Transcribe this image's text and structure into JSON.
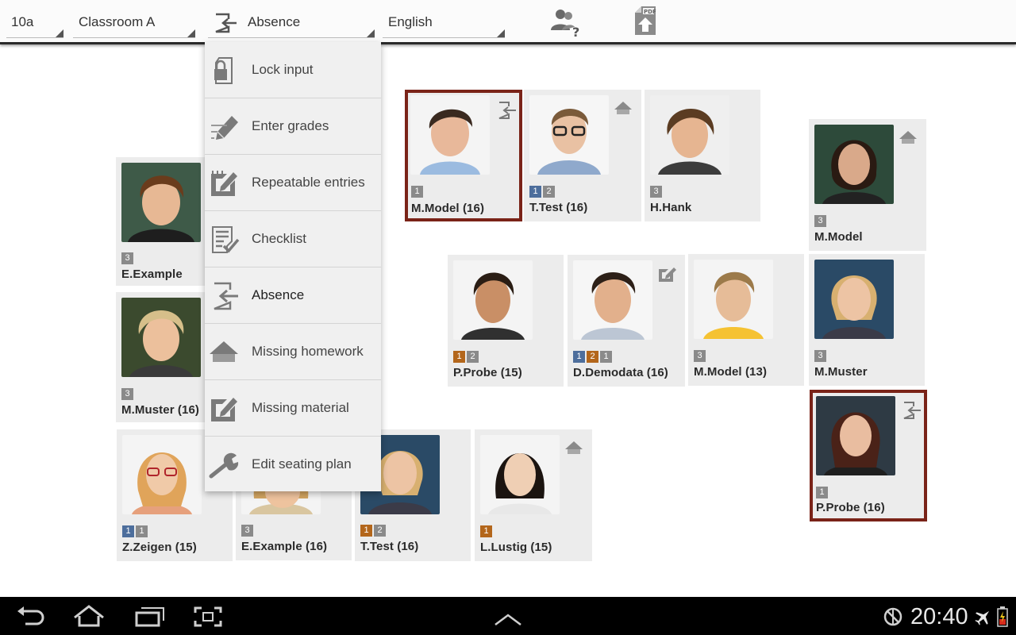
{
  "toolbar": {
    "class_select": "10a",
    "room_select": "Classroom A",
    "mode_select": "Absence",
    "subject_select": "English"
  },
  "menu": {
    "items": [
      {
        "label": "Lock input",
        "icon": "lock-icon"
      },
      {
        "label": "Enter grades",
        "icon": "pencil-icon"
      },
      {
        "label": "Repeatable entries",
        "icon": "notepad-pen-icon"
      },
      {
        "label": "Checklist",
        "icon": "checklist-icon"
      },
      {
        "label": "Absence",
        "icon": "absence-exit-icon"
      },
      {
        "label": "Missing homework",
        "icon": "house-icon"
      },
      {
        "label": "Missing material",
        "icon": "material-pen-icon"
      },
      {
        "label": "Edit seating plan",
        "icon": "wrench-icon"
      }
    ],
    "selected": "Absence"
  },
  "students": [
    {
      "name": "M.Model  (16)",
      "badges": [
        {
          "text": "1",
          "color": "gray"
        }
      ],
      "status_icon": "absence-exit-icon",
      "highlighted": true
    },
    {
      "name": "T.Test  (16)",
      "badges": [
        {
          "text": "1",
          "color": "blue"
        },
        {
          "text": "2",
          "color": "gray"
        }
      ],
      "status_icon": "house-icon"
    },
    {
      "name": "H.Hank",
      "badges": [
        {
          "text": "3",
          "color": "gray"
        }
      ]
    },
    {
      "name": "M.Model",
      "badges": [
        {
          "text": "3",
          "color": "gray"
        }
      ],
      "status_icon": "house-icon"
    },
    {
      "name": "E.Example",
      "badges": [
        {
          "text": "3",
          "color": "gray"
        }
      ]
    },
    {
      "name": "P.Probe  (15)",
      "badges": [
        {
          "text": "1",
          "color": "orange"
        },
        {
          "text": "2",
          "color": "gray"
        }
      ]
    },
    {
      "name": "D.Demodata  (16)",
      "badges": [
        {
          "text": "1",
          "color": "blue"
        },
        {
          "text": "2",
          "color": "orange"
        },
        {
          "text": "1",
          "color": "gray"
        }
      ],
      "status_icon": "notepad-pen-icon"
    },
    {
      "name": "M.Model  (13)",
      "badges": [
        {
          "text": "3",
          "color": "gray"
        }
      ]
    },
    {
      "name": "M.Muster",
      "badges": [
        {
          "text": "3",
          "color": "gray"
        }
      ]
    },
    {
      "name": "M.Muster  (16)",
      "badges": [
        {
          "text": "3",
          "color": "gray"
        }
      ]
    },
    {
      "name": "P.Probe  (16)",
      "badges": [
        {
          "text": "1",
          "color": "gray"
        }
      ],
      "status_icon": "absence-exit-icon",
      "highlighted": true
    },
    {
      "name": "Z.Zeigen  (15)",
      "badges": [
        {
          "text": "1",
          "color": "blue"
        },
        {
          "text": "1",
          "color": "gray"
        }
      ]
    },
    {
      "name": "E.Example  (16)",
      "badges": [
        {
          "text": "3",
          "color": "gray"
        }
      ]
    },
    {
      "name": "T.Test  (16)",
      "badges": [
        {
          "text": "1",
          "color": "orange"
        },
        {
          "text": "2",
          "color": "gray"
        }
      ]
    },
    {
      "name": "L.Lustig  (15)",
      "badges": [
        {
          "text": "1",
          "color": "orange"
        }
      ],
      "status_icon": "house-icon"
    }
  ],
  "system_bar": {
    "time": "20:40"
  },
  "colors": {
    "highlight_border": "#7a2318",
    "badge_blue": "#4d6e9c",
    "badge_orange": "#b3661b",
    "badge_gray": "#8a8a8a",
    "card_bg": "#ececec"
  }
}
